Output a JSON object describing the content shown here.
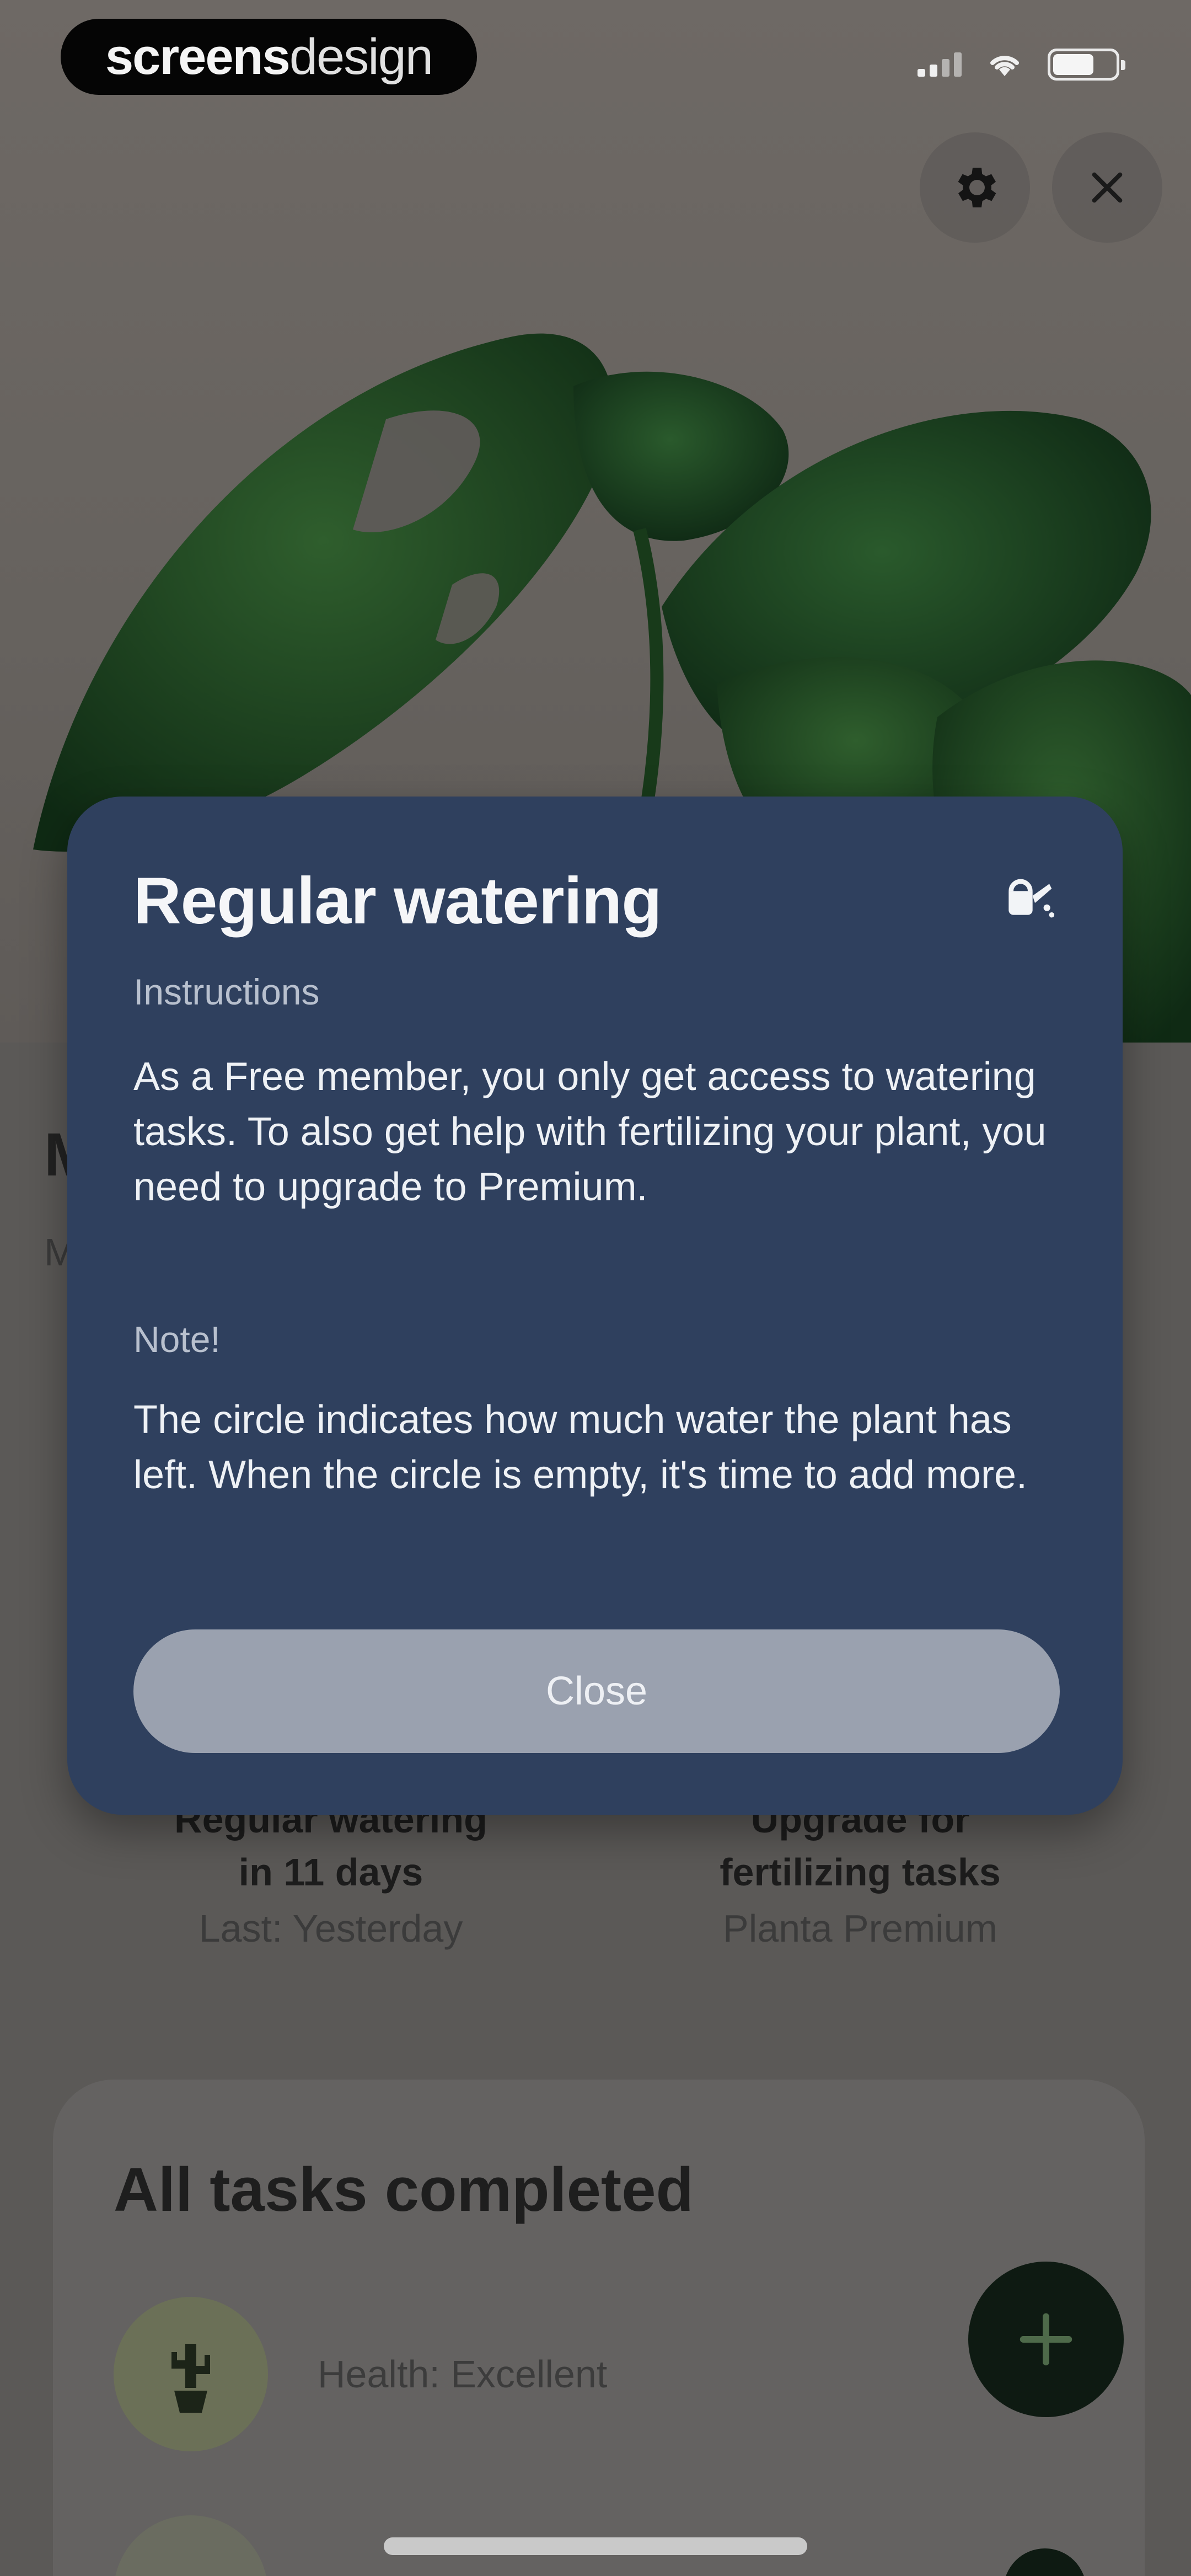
{
  "status_bar": {
    "brand_bold": "screens",
    "brand_light": "design",
    "signal_icon": "cellular-signal-icon",
    "wifi_icon": "wifi-icon",
    "battery_icon": "battery-icon"
  },
  "header": {
    "settings_icon": "gear-icon",
    "close_icon": "close-icon"
  },
  "modal": {
    "title": "Regular watering",
    "icon": "watering-can-icon",
    "instructions_label": "Instructions",
    "instructions_text": "As a Free member, you only get access to watering tasks. To also get help with fertilizing your plant, you need to upgrade to Premium.",
    "note_label": "Note!",
    "note_text": "The circle indicates how much water the plant has left. When the circle is empty, it's time to add more.",
    "close_label": "Close"
  },
  "tasks": {
    "watering": {
      "title_line1": "Regular watering",
      "title_line2": "in 11 days",
      "subtitle": "Last: Yesterday"
    },
    "fertilizing": {
      "title_line1": "Upgrade for",
      "title_line2": "fertilizing tasks",
      "subtitle": "Planta Premium"
    }
  },
  "tasks_card": {
    "title": "All tasks completed",
    "health_label": "Health: Excellent",
    "add_icon": "plus-icon"
  },
  "colors": {
    "modal_background": "#2f405e",
    "close_button": "#9aa1af",
    "fab": "#0e1a12"
  }
}
